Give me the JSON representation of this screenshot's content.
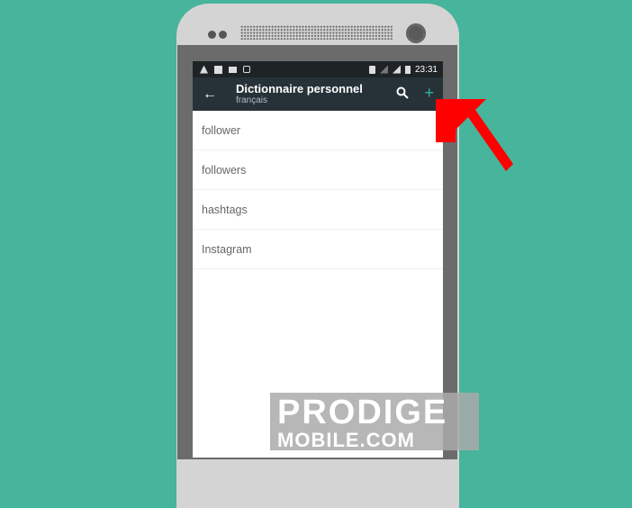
{
  "status_bar": {
    "left_icons": [
      "vlc-icon",
      "facebook-icon",
      "screen-icon",
      "sync-icon"
    ],
    "right_icons": [
      "vibrate-icon",
      "signal-empty-icon",
      "signal-icon",
      "battery-icon"
    ],
    "time": "23:31"
  },
  "app_bar": {
    "title": "Dictionnaire personnel",
    "subtitle": "français",
    "back_icon": "←",
    "add_icon": "+",
    "accent_color": "#29b6a0"
  },
  "words": [
    {
      "label": "follower"
    },
    {
      "label": "followers"
    },
    {
      "label": "hashtags"
    },
    {
      "label": "Instagram"
    }
  ],
  "annotation": {
    "arrow_color": "#ff0000",
    "points_to": "add-button"
  },
  "watermark": {
    "line1": "PRODIGE",
    "line2": "MOBILE.COM"
  }
}
